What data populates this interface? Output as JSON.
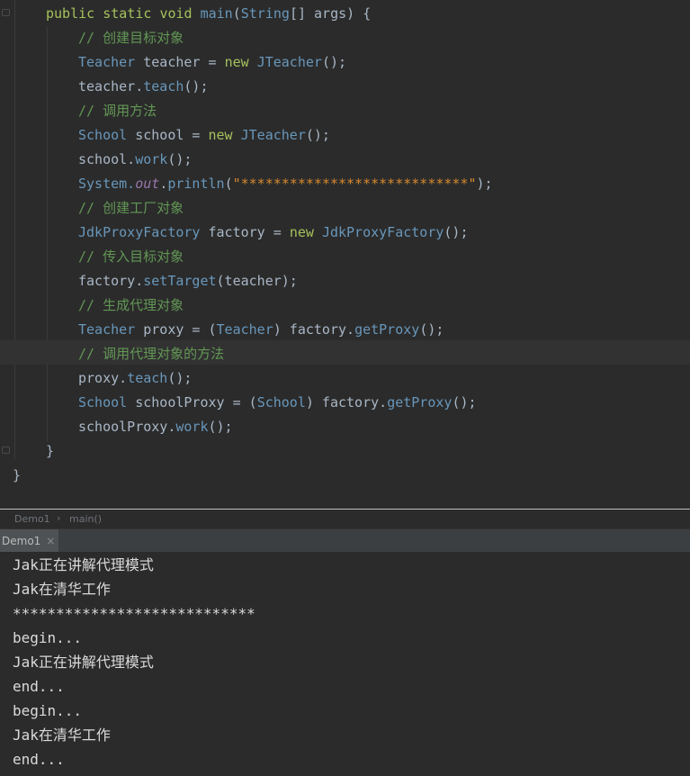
{
  "editor": {
    "lines": [
      [
        {
          "t": "public ",
          "c": "kwg"
        },
        {
          "t": "static ",
          "c": "kwg"
        },
        {
          "t": "void ",
          "c": "kwg"
        },
        {
          "t": "main",
          "c": "method"
        },
        {
          "t": "(",
          "c": "punct"
        },
        {
          "t": "String",
          "c": "type"
        },
        {
          "t": "[] args) {",
          "c": "plain"
        }
      ],
      [
        {
          "t": "// 创建目标对象",
          "c": "cmt"
        }
      ],
      [
        {
          "t": "Teacher",
          "c": "type"
        },
        {
          "t": " teacher = ",
          "c": "plain"
        },
        {
          "t": "new ",
          "c": "kwg"
        },
        {
          "t": "JTeacher",
          "c": "type"
        },
        {
          "t": "();",
          "c": "plain"
        }
      ],
      [
        {
          "t": "teacher.",
          "c": "plain"
        },
        {
          "t": "teach",
          "c": "method"
        },
        {
          "t": "();",
          "c": "plain"
        }
      ],
      [
        {
          "t": "// 调用方法",
          "c": "cmt"
        }
      ],
      [
        {
          "t": "School",
          "c": "type"
        },
        {
          "t": " school = ",
          "c": "plain"
        },
        {
          "t": "new ",
          "c": "kwg"
        },
        {
          "t": "JTeacher",
          "c": "type"
        },
        {
          "t": "();",
          "c": "plain"
        }
      ],
      [
        {
          "t": "school.",
          "c": "plain"
        },
        {
          "t": "work",
          "c": "method"
        },
        {
          "t": "();",
          "c": "plain"
        }
      ],
      [
        {
          "t": "System.",
          "c": "type"
        },
        {
          "t": "out",
          "c": "field"
        },
        {
          "t": ".",
          "c": "plain"
        },
        {
          "t": "println",
          "c": "method"
        },
        {
          "t": "(",
          "c": "plain"
        },
        {
          "t": "\"****************************\"",
          "c": "str"
        },
        {
          "t": ");",
          "c": "plain"
        }
      ],
      [
        {
          "t": "// 创建工厂对象",
          "c": "cmt"
        }
      ],
      [
        {
          "t": "JdkProxyFactory",
          "c": "type"
        },
        {
          "t": " factory = ",
          "c": "plain"
        },
        {
          "t": "new ",
          "c": "kwg"
        },
        {
          "t": "JdkProxyFactory",
          "c": "type"
        },
        {
          "t": "();",
          "c": "plain"
        }
      ],
      [
        {
          "t": "// 传入目标对象",
          "c": "cmt"
        }
      ],
      [
        {
          "t": "factory.",
          "c": "plain"
        },
        {
          "t": "setTarget",
          "c": "method"
        },
        {
          "t": "(teacher);",
          "c": "plain"
        }
      ],
      [
        {
          "t": "// 生成代理对象",
          "c": "cmt"
        }
      ],
      [
        {
          "t": "Teacher",
          "c": "type"
        },
        {
          "t": " proxy = (",
          "c": "plain"
        },
        {
          "t": "Teacher",
          "c": "type"
        },
        {
          "t": ") factory.",
          "c": "plain"
        },
        {
          "t": "getProxy",
          "c": "method"
        },
        {
          "t": "();",
          "c": "plain"
        }
      ],
      [
        {
          "t": "// 调用代理对象的方法",
          "c": "cmt"
        }
      ],
      [
        {
          "t": "proxy.",
          "c": "plain"
        },
        {
          "t": "teach",
          "c": "method"
        },
        {
          "t": "();",
          "c": "plain"
        }
      ],
      [
        {
          "t": "School",
          "c": "type"
        },
        {
          "t": " schoolProxy = (",
          "c": "plain"
        },
        {
          "t": "School",
          "c": "type"
        },
        {
          "t": ") factory.",
          "c": "plain"
        },
        {
          "t": "getProxy",
          "c": "method"
        },
        {
          "t": "();",
          "c": "plain"
        }
      ],
      [
        {
          "t": "schoolProxy.",
          "c": "plain"
        },
        {
          "t": "work",
          "c": "method"
        },
        {
          "t": "();",
          "c": "plain"
        }
      ],
      [
        {
          "t": "}",
          "c": "plain"
        }
      ],
      [
        {
          "t": "}",
          "c": "plain"
        }
      ]
    ]
  },
  "breadcrumb": {
    "items": [
      "Demo1",
      "main()"
    ],
    "separator": "›"
  },
  "run_tab": {
    "label": "Demo1",
    "close": "×"
  },
  "console": {
    "lines": [
      "Jak正在讲解代理模式",
      "Jak在清华工作",
      "****************************",
      "begin...",
      "Jak正在讲解代理模式",
      "end...",
      "begin...",
      "Jak在清华工作",
      "end..."
    ]
  }
}
